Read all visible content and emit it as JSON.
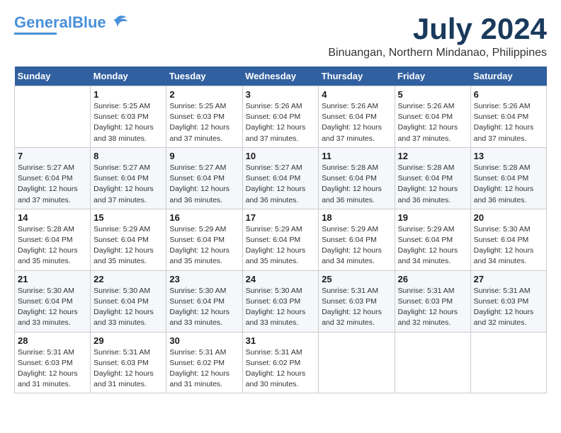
{
  "header": {
    "logo_general": "General",
    "logo_blue": "Blue",
    "title": "July 2024",
    "subtitle": "Binuangan, Northern Mindanao, Philippines"
  },
  "calendar": {
    "columns": [
      "Sunday",
      "Monday",
      "Tuesday",
      "Wednesday",
      "Thursday",
      "Friday",
      "Saturday"
    ],
    "weeks": [
      [
        {
          "day": "",
          "info": ""
        },
        {
          "day": "1",
          "info": "Sunrise: 5:25 AM\nSunset: 6:03 PM\nDaylight: 12 hours\nand 38 minutes."
        },
        {
          "day": "2",
          "info": "Sunrise: 5:25 AM\nSunset: 6:03 PM\nDaylight: 12 hours\nand 37 minutes."
        },
        {
          "day": "3",
          "info": "Sunrise: 5:26 AM\nSunset: 6:04 PM\nDaylight: 12 hours\nand 37 minutes."
        },
        {
          "day": "4",
          "info": "Sunrise: 5:26 AM\nSunset: 6:04 PM\nDaylight: 12 hours\nand 37 minutes."
        },
        {
          "day": "5",
          "info": "Sunrise: 5:26 AM\nSunset: 6:04 PM\nDaylight: 12 hours\nand 37 minutes."
        },
        {
          "day": "6",
          "info": "Sunrise: 5:26 AM\nSunset: 6:04 PM\nDaylight: 12 hours\nand 37 minutes."
        }
      ],
      [
        {
          "day": "7",
          "info": "Sunrise: 5:27 AM\nSunset: 6:04 PM\nDaylight: 12 hours\nand 37 minutes."
        },
        {
          "day": "8",
          "info": "Sunrise: 5:27 AM\nSunset: 6:04 PM\nDaylight: 12 hours\nand 37 minutes."
        },
        {
          "day": "9",
          "info": "Sunrise: 5:27 AM\nSunset: 6:04 PM\nDaylight: 12 hours\nand 36 minutes."
        },
        {
          "day": "10",
          "info": "Sunrise: 5:27 AM\nSunset: 6:04 PM\nDaylight: 12 hours\nand 36 minutes."
        },
        {
          "day": "11",
          "info": "Sunrise: 5:28 AM\nSunset: 6:04 PM\nDaylight: 12 hours\nand 36 minutes."
        },
        {
          "day": "12",
          "info": "Sunrise: 5:28 AM\nSunset: 6:04 PM\nDaylight: 12 hours\nand 36 minutes."
        },
        {
          "day": "13",
          "info": "Sunrise: 5:28 AM\nSunset: 6:04 PM\nDaylight: 12 hours\nand 36 minutes."
        }
      ],
      [
        {
          "day": "14",
          "info": "Sunrise: 5:28 AM\nSunset: 6:04 PM\nDaylight: 12 hours\nand 35 minutes."
        },
        {
          "day": "15",
          "info": "Sunrise: 5:29 AM\nSunset: 6:04 PM\nDaylight: 12 hours\nand 35 minutes."
        },
        {
          "day": "16",
          "info": "Sunrise: 5:29 AM\nSunset: 6:04 PM\nDaylight: 12 hours\nand 35 minutes."
        },
        {
          "day": "17",
          "info": "Sunrise: 5:29 AM\nSunset: 6:04 PM\nDaylight: 12 hours\nand 35 minutes."
        },
        {
          "day": "18",
          "info": "Sunrise: 5:29 AM\nSunset: 6:04 PM\nDaylight: 12 hours\nand 34 minutes."
        },
        {
          "day": "19",
          "info": "Sunrise: 5:29 AM\nSunset: 6:04 PM\nDaylight: 12 hours\nand 34 minutes."
        },
        {
          "day": "20",
          "info": "Sunrise: 5:30 AM\nSunset: 6:04 PM\nDaylight: 12 hours\nand 34 minutes."
        }
      ],
      [
        {
          "day": "21",
          "info": "Sunrise: 5:30 AM\nSunset: 6:04 PM\nDaylight: 12 hours\nand 33 minutes."
        },
        {
          "day": "22",
          "info": "Sunrise: 5:30 AM\nSunset: 6:04 PM\nDaylight: 12 hours\nand 33 minutes."
        },
        {
          "day": "23",
          "info": "Sunrise: 5:30 AM\nSunset: 6:04 PM\nDaylight: 12 hours\nand 33 minutes."
        },
        {
          "day": "24",
          "info": "Sunrise: 5:30 AM\nSunset: 6:03 PM\nDaylight: 12 hours\nand 33 minutes."
        },
        {
          "day": "25",
          "info": "Sunrise: 5:31 AM\nSunset: 6:03 PM\nDaylight: 12 hours\nand 32 minutes."
        },
        {
          "day": "26",
          "info": "Sunrise: 5:31 AM\nSunset: 6:03 PM\nDaylight: 12 hours\nand 32 minutes."
        },
        {
          "day": "27",
          "info": "Sunrise: 5:31 AM\nSunset: 6:03 PM\nDaylight: 12 hours\nand 32 minutes."
        }
      ],
      [
        {
          "day": "28",
          "info": "Sunrise: 5:31 AM\nSunset: 6:03 PM\nDaylight: 12 hours\nand 31 minutes."
        },
        {
          "day": "29",
          "info": "Sunrise: 5:31 AM\nSunset: 6:03 PM\nDaylight: 12 hours\nand 31 minutes."
        },
        {
          "day": "30",
          "info": "Sunrise: 5:31 AM\nSunset: 6:02 PM\nDaylight: 12 hours\nand 31 minutes."
        },
        {
          "day": "31",
          "info": "Sunrise: 5:31 AM\nSunset: 6:02 PM\nDaylight: 12 hours\nand 30 minutes."
        },
        {
          "day": "",
          "info": ""
        },
        {
          "day": "",
          "info": ""
        },
        {
          "day": "",
          "info": ""
        }
      ]
    ]
  }
}
